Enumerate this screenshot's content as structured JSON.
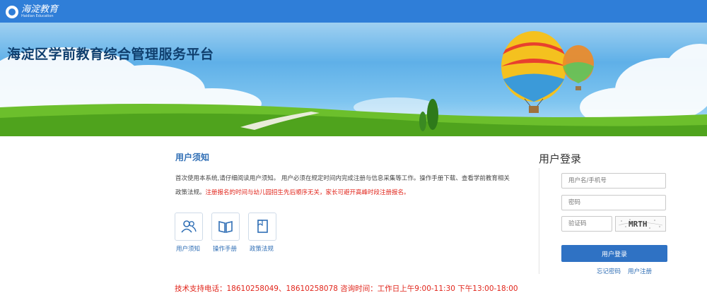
{
  "header": {
    "logo_text": "海淀教育",
    "logo_subtext": "Haidian Education"
  },
  "banner": {
    "title": "海淀区学前教育综合管理服务平台"
  },
  "notice": {
    "title": "用户须知",
    "text_normal": "首次使用本系统,请仔细阅读用户须知。 用户必须在规定时间内完成注册与信息采集等工作。操作手册下载、查看学前教育相关政策法规。",
    "text_red": "注册报名的时间与幼儿园招生先后顺序无关，家长可避开高峰时段注册报名。",
    "icons": [
      {
        "label": "用户须知",
        "icon": "users-icon"
      },
      {
        "label": "操作手册",
        "icon": "book-icon"
      },
      {
        "label": "政策法规",
        "icon": "document-icon"
      }
    ],
    "support_text": "技术支持电话：18610258049、18610258078   咨询时间：工作日上午9:00-11:30  下午13:00-18:00"
  },
  "login": {
    "title": "用户登录",
    "username_placeholder": "用户名/手机号",
    "password_placeholder": "密码",
    "captcha_placeholder": "验证码",
    "captcha_text": "MRTH",
    "submit_label": "用户登录",
    "forgot_label": "忘记密码",
    "register_label": "用户注册"
  },
  "colors": {
    "topbar": "#2f7ed8",
    "accent": "#2f72c4",
    "alert_red": "#e1251b"
  }
}
